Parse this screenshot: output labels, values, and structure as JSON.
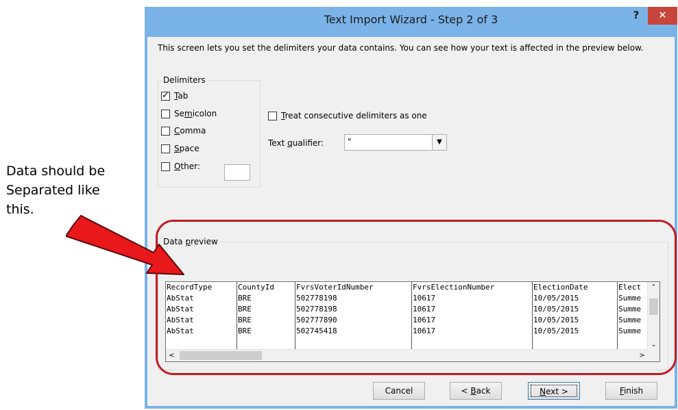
{
  "annotation": {
    "lines": [
      "Data should be",
      "Separated like",
      "this."
    ]
  },
  "dialog": {
    "title": "Text Import Wizard - Step 2 of 3",
    "help": "?",
    "close": "✕"
  },
  "intro": "This screen lets you set the delimiters your data contains.  You can see how your text is affected in the preview below.",
  "delimiters": {
    "label": "Delimiters",
    "tab": {
      "pre": "",
      "key": "T",
      "post": "ab",
      "checked": true
    },
    "semicolon": {
      "pre": "Se",
      "key": "m",
      "post": "icolon",
      "checked": false
    },
    "comma": {
      "pre": "",
      "key": "C",
      "post": "omma",
      "checked": false
    },
    "space": {
      "pre": "",
      "key": "S",
      "post": "pace",
      "checked": false
    },
    "other": {
      "pre": "",
      "key": "O",
      "post": "ther:",
      "checked": false,
      "value": ""
    }
  },
  "consecutive": {
    "pre": "",
    "key": "T",
    "post": "reat consecutive delimiters as one",
    "checked": false
  },
  "qualifier": {
    "pre": "Text ",
    "key": "q",
    "post": "ualifier:",
    "value": "\""
  },
  "preview": {
    "label_pre": "Data ",
    "label_key": "p",
    "label_post": "review",
    "columns": [
      {
        "header": "RecordType",
        "cells": [
          "AbStat",
          "AbStat",
          "AbStat",
          "AbStat"
        ]
      },
      {
        "header": "CountyId",
        "cells": [
          "BRE",
          "BRE",
          "BRE",
          "BRE"
        ]
      },
      {
        "header": "FvrsVoterIdNumber",
        "cells": [
          "502778198",
          "502778198",
          "502777890",
          "502745418"
        ]
      },
      {
        "header": "FvrsElectionNumber",
        "cells": [
          "10617",
          "10617",
          "10617",
          "10617"
        ]
      },
      {
        "header": "ElectionDate",
        "cells": [
          "10/05/2015",
          "10/05/2015",
          "10/05/2015",
          "10/05/2015"
        ]
      },
      {
        "header": "Elect",
        "cells": [
          "Summe",
          "Summe",
          "Summe",
          "Summe"
        ]
      }
    ]
  },
  "buttons": {
    "cancel": "Cancel",
    "back": {
      "pre": "< ",
      "key": "B",
      "post": "ack"
    },
    "next": {
      "pre": "",
      "key": "N",
      "post": "ext >"
    },
    "finish": {
      "pre": "",
      "key": "F",
      "post": "inish"
    }
  }
}
